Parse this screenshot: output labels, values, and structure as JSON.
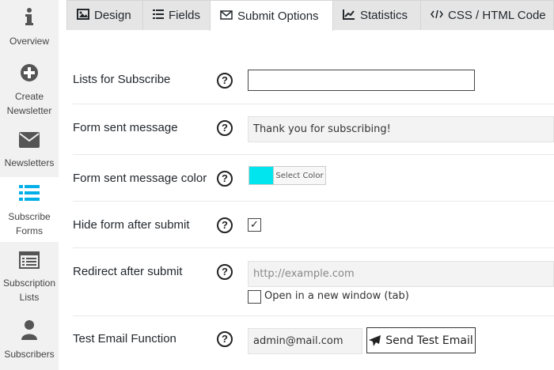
{
  "sidebar": {
    "items": [
      {
        "label": "Overview",
        "icon": "info-icon"
      },
      {
        "label": "Create\nNewsletter",
        "icon": "plus-circle-icon"
      },
      {
        "label": "Newsletters",
        "icon": "envelope-icon"
      },
      {
        "label": "Subscribe\nForms",
        "icon": "list-icon",
        "active": true
      },
      {
        "label": "Subscription\nLists",
        "icon": "list-box-icon"
      },
      {
        "label": "Subscribers",
        "icon": "user-icon"
      }
    ],
    "active_color": "#00aee8"
  },
  "tabs": [
    {
      "label": "Design",
      "icon": "image-icon"
    },
    {
      "label": "Fields",
      "icon": "list-icon"
    },
    {
      "label": "Submit Options",
      "icon": "envelope-icon",
      "active": true
    },
    {
      "label": "Statistics",
      "icon": "chart-icon"
    },
    {
      "label": "CSS / HTML Code",
      "icon": "code-icon"
    }
  ],
  "rows": {
    "lists": {
      "label": "Lists for Subscribe",
      "value": ""
    },
    "sent_message": {
      "label": "Form sent message",
      "value": "Thank you for subscribing!"
    },
    "message_color": {
      "label": "Form sent message color",
      "button": "Select Color",
      "color": "#00e5ee"
    },
    "hide_form": {
      "label": "Hide form after submit",
      "checked": true
    },
    "redirect": {
      "label": "Redirect after submit",
      "placeholder": "http://example.com",
      "new_window_label": "Open in a new window (tab)",
      "new_window_checked": false
    },
    "test_email": {
      "label": "Test Email Function",
      "value": "admin@mail.com",
      "button": "Send Test Email"
    }
  },
  "help_glyph": "?",
  "check_glyph": "✓"
}
